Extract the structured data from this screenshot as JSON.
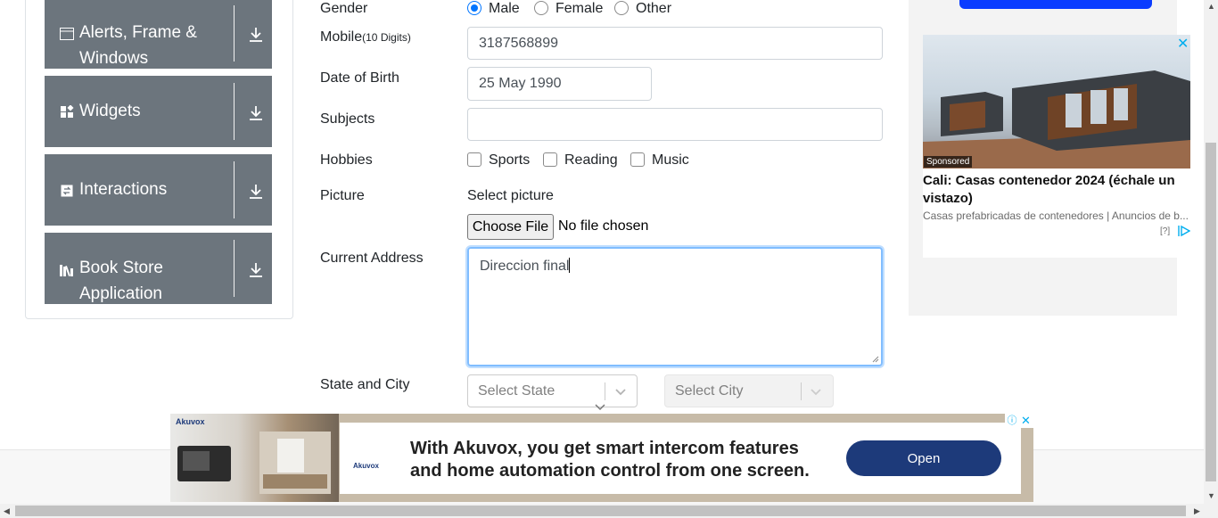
{
  "sidebar": {
    "groups": [
      {
        "label_line1": "Alerts, Frame &",
        "label_line2": "Windows",
        "icon": "window-icon"
      },
      {
        "label_line1": "Widgets",
        "label_line2": "",
        "icon": "widgets-icon"
      },
      {
        "label_line1": "Interactions",
        "label_line2": "",
        "icon": "interactions-icon"
      },
      {
        "label_line1": "Book Store",
        "label_line2": "Application",
        "icon": "book-icon"
      }
    ]
  },
  "form": {
    "gender_label": "Gender",
    "gender_options": [
      "Male",
      "Female",
      "Other"
    ],
    "gender_selected": "Male",
    "mobile_label": "Mobile",
    "mobile_hint": "(10 Digits)",
    "mobile_value": "3187568899",
    "dob_label": "Date of Birth",
    "dob_value": "25 May 1990",
    "subjects_label": "Subjects",
    "subjects_value": "",
    "hobbies_label": "Hobbies",
    "hobbies_options": [
      "Sports",
      "Reading",
      "Music"
    ],
    "picture_label": "Picture",
    "picture_prompt": "Select picture",
    "choose_file_label": "Choose File",
    "file_status": "No file chosen",
    "address_label": "Current Address",
    "address_value": "Direccion final",
    "state_city_label": "State and City",
    "state_placeholder": "Select State",
    "city_placeholder": "Select City"
  },
  "right_ad": {
    "sponsored": "Sponsored",
    "headline": "Cali: Casas contenedor 2024 (échale un vistazo)",
    "description": "Casas prefabricadas de contenedores | Anuncios de b...",
    "help": "[?]"
  },
  "bottom_ad": {
    "brand": "Akuvox",
    "line1": "With Akuvox, you get smart intercom features",
    "line2": "and home automation control from one screen.",
    "cta": "Open"
  },
  "colors": {
    "sidebar_bg": "#6c757d",
    "radio_accent": "#0075ff",
    "focus_border": "#80bdff",
    "ad_cta": "#1d3a7a"
  }
}
